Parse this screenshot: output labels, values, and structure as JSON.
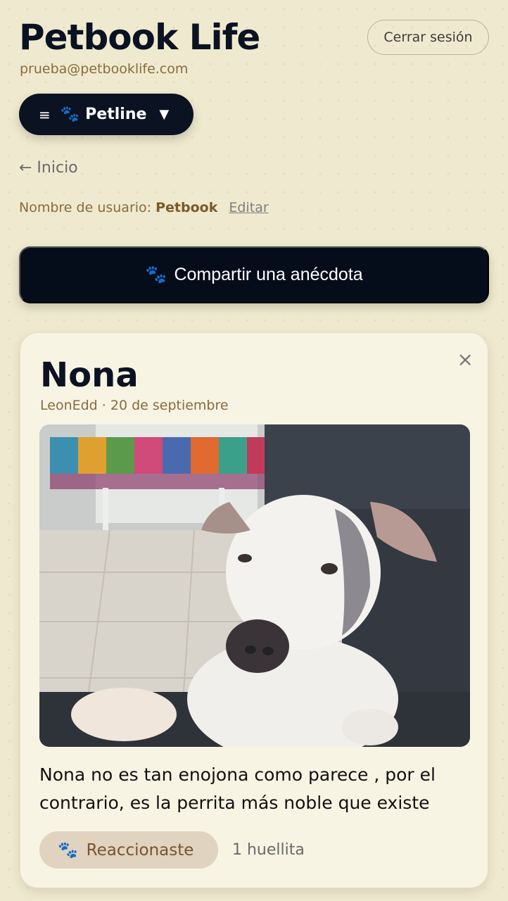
{
  "app": {
    "title": "Petbook Life",
    "email": "prueba@petbooklife.com",
    "logout_label": "Cerrar sesión"
  },
  "nav": {
    "menu_icon": "≡",
    "paw_icon": "🐾",
    "section_label": "Petline",
    "caret": "▼"
  },
  "back": {
    "label": "← Inicio"
  },
  "user": {
    "username_prefix": "Nombre de usuario:",
    "username": "Petbook",
    "edit_label": "Editar"
  },
  "share": {
    "paw_icon": "🐾",
    "label": "Compartir una anécdota"
  },
  "post": {
    "title": "Nona",
    "meta": "LeonEdd · 20 de septiembre",
    "close_icon": "×",
    "photo_alt": "Perro blanco y gris sobre un sofá",
    "text": "Nona no es tan enojona como parece , por el contrario, es la perrita más noble que existe",
    "react_paw": "🐾",
    "react_label": "Reaccionaste",
    "react_count": "1 huellita"
  },
  "colors": {
    "background": "#efeacf",
    "primary_dark": "#0b1222",
    "accent_brown": "#8a6a3d",
    "react_bg": "#e0d3bf"
  }
}
